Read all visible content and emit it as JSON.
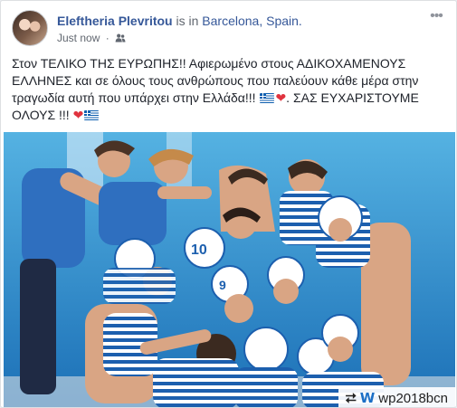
{
  "post": {
    "author": "Eleftheria Plevritou",
    "location_prefix": "is in",
    "location": "Barcelona, Spain.",
    "timestamp": "Just now",
    "separator": "·",
    "audience_icon": "friends-icon",
    "more_icon": "more-options-icon",
    "more_label": "•••",
    "text": {
      "part1": "Στον ΤΕΛΙΚΟ ΤΗΣ ΕΥΡΩΠΗΣ!! Αφιερωμένο στους ΑΔΙΚΟΧΑΜΕΝΟΥΣ ΕΛΛΗΝΕΣ και σε όλους τους ανθρώπους που παλεύουν κάθε μέρα στην τραγωδία αυτή που υπάρχει στην Ελλάδα!!!",
      "part2": ". ΣΑΣ ΕΥΧΑΡΙΣΤΟΥΜΕ ΟΛΟΥΣ !!!",
      "emoji": [
        "greek-flag-icon",
        "red-heart-icon"
      ],
      "heart": "❤"
    }
  },
  "photo": {
    "watermark_repost": "⮂",
    "watermark_logo": "W",
    "watermark_text": "wp2018bcn",
    "colors": {
      "pool": "#2d8ed0",
      "cap": "#ffffff",
      "suit": "#1c5fae",
      "staff": "#2f6fbf",
      "skin": "#d9a584"
    }
  }
}
